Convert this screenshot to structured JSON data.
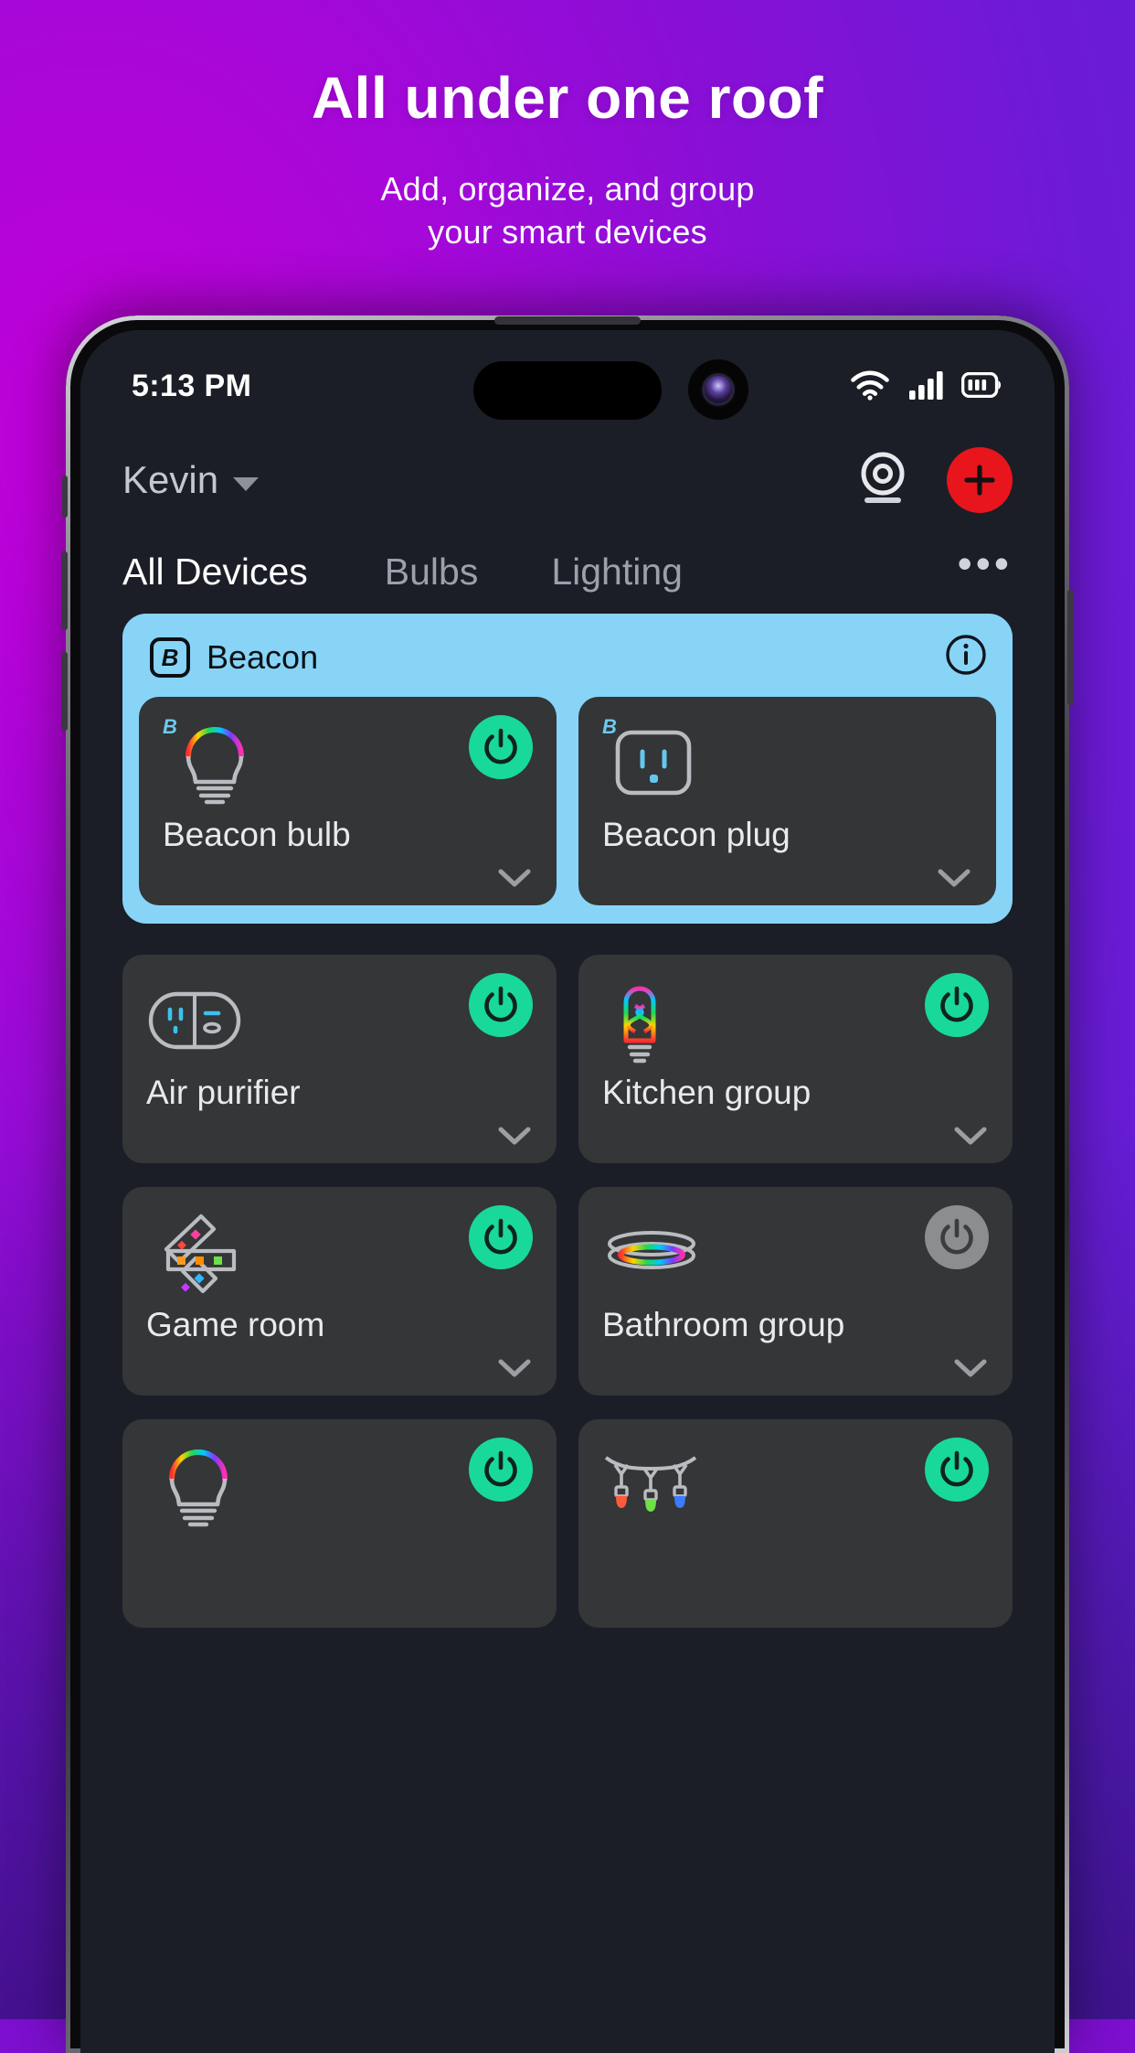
{
  "promo": {
    "title": "All under one roof",
    "subtitle_line1": "Add, organize, and group",
    "subtitle_line2": "your smart devices"
  },
  "status_bar": {
    "time": "5:13 PM",
    "icons": [
      "wifi-icon",
      "cellular-signal-icon",
      "battery-icon"
    ]
  },
  "header": {
    "profile_name": "Kevin",
    "caret_icon": "chevron-down-icon",
    "camera_icon": "camera-icon",
    "add_icon": "plus-icon"
  },
  "tabs": [
    {
      "label": "All Devices",
      "active": true
    },
    {
      "label": "Bulbs",
      "active": false
    },
    {
      "label": "Lighting",
      "active": false
    }
  ],
  "tabs_overflow_label": "•••",
  "colors": {
    "accent_green": "#18d99a",
    "accent_red": "#e8151c",
    "group_blue": "#88d4f7",
    "card_gray": "#343638",
    "screen_bg": "#1b1e26",
    "off_gray": "#8b8d8f"
  },
  "group": {
    "name": "Beacon",
    "logo_letter": "B",
    "info_icon": "info-icon",
    "devices": [
      {
        "name": "Beacon bulb",
        "icon": "rgb-bulb-icon",
        "brand_tag": "B",
        "power": "on",
        "expand_icon": "chevron-down-icon"
      },
      {
        "name": "Beacon plug",
        "icon": "smart-plug-icon",
        "brand_tag": "B",
        "power": "off-no-button",
        "expand_icon": "chevron-down-icon"
      }
    ]
  },
  "devices": [
    {
      "name": "Air purifier",
      "icon": "air-purifier-icon",
      "brand_tag": "",
      "power": "on",
      "expand_icon": "chevron-down-icon"
    },
    {
      "name": "Kitchen group",
      "icon": "rgb-edison-bulb-icon",
      "brand_tag": "",
      "power": "on",
      "expand_icon": "chevron-down-icon"
    },
    {
      "name": "Game room",
      "icon": "light-strip-icon",
      "brand_tag": "",
      "power": "on",
      "expand_icon": "chevron-down-icon"
    },
    {
      "name": "Bathroom group",
      "icon": "ceiling-ring-light-icon",
      "brand_tag": "",
      "power": "off",
      "expand_icon": "chevron-down-icon"
    },
    {
      "name": "",
      "icon": "rgb-bulb-icon",
      "brand_tag": "",
      "power": "on",
      "expand_icon": ""
    },
    {
      "name": "",
      "icon": "string-lights-icon",
      "brand_tag": "",
      "power": "on",
      "expand_icon": ""
    }
  ]
}
